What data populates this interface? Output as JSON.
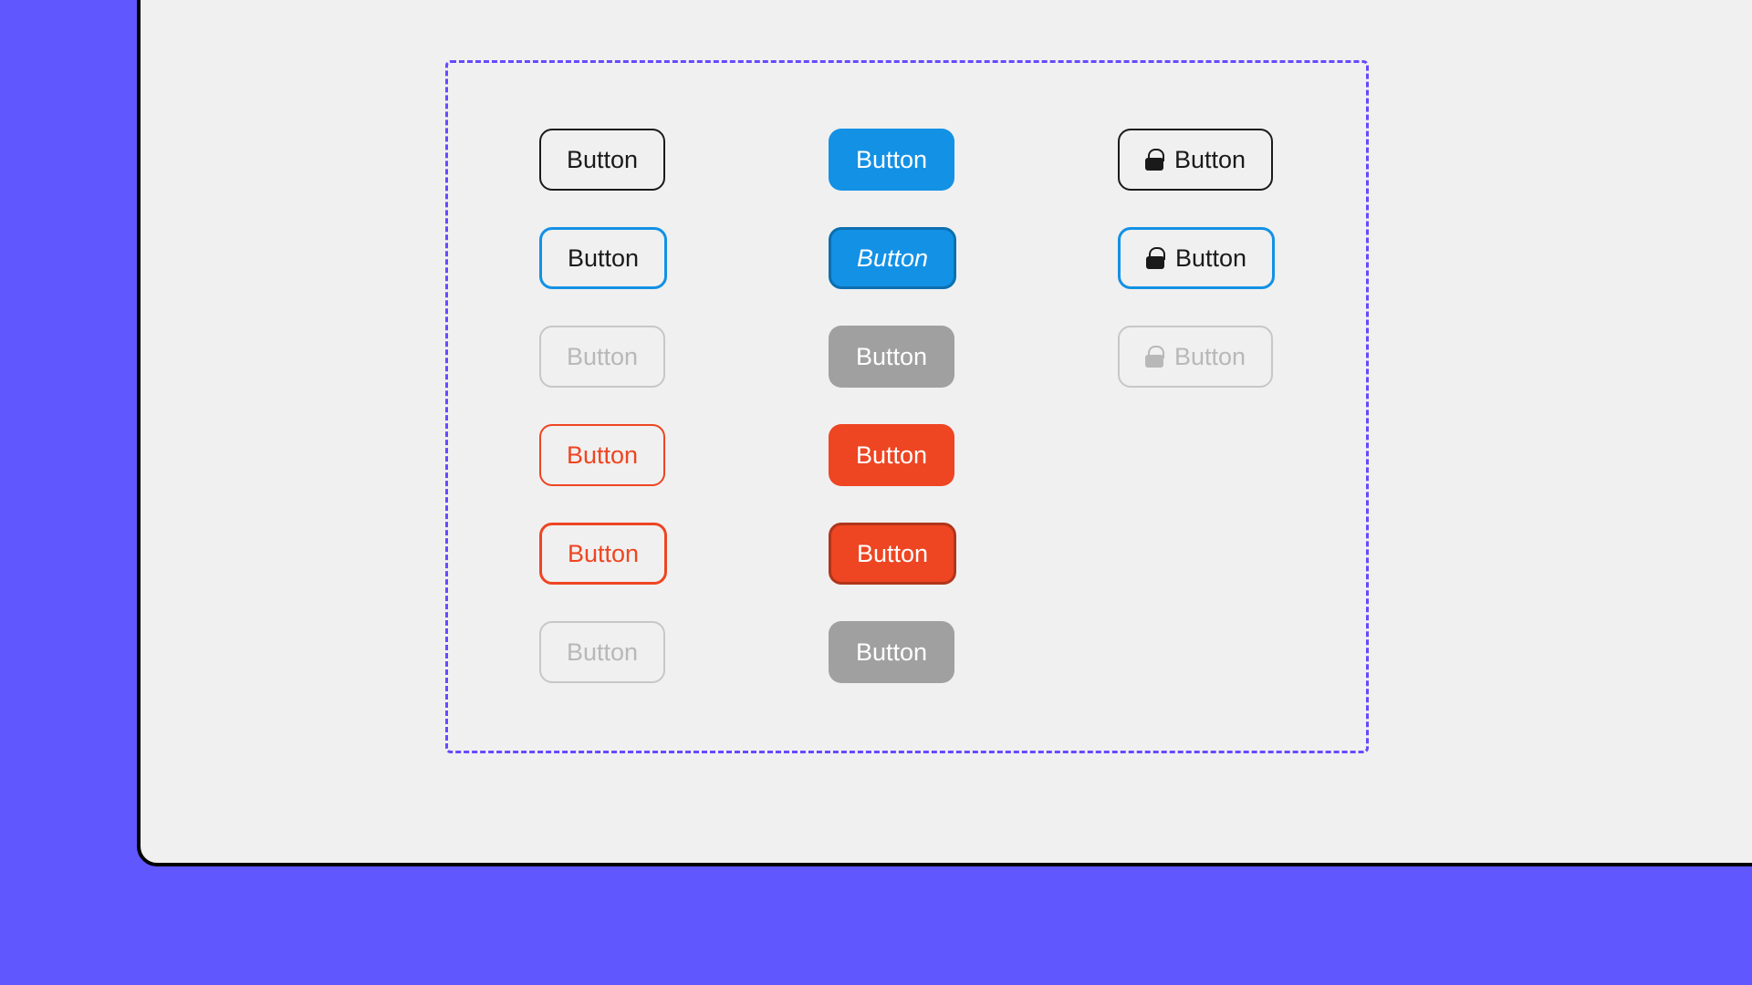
{
  "buttons": {
    "col1": {
      "r1": "Button",
      "r2": "Button",
      "r3": "Button",
      "r4": "Button",
      "r5": "Button",
      "r6": "Button"
    },
    "col2": {
      "r1": "Button",
      "r2": "Button",
      "r3": "Button",
      "r4": "Button",
      "r5": "Button",
      "r6": "Button"
    },
    "col3": {
      "r1": "Button",
      "r2": "Button",
      "r3": "Button"
    }
  },
  "colors": {
    "outer_bg": "#6057ff",
    "stage_bg": "#f0f0f0",
    "dashed_border": "#6749ff",
    "primary_blue": "#1391e5",
    "danger_red": "#ee4522",
    "disabled_grey": "#a0a0a0"
  }
}
